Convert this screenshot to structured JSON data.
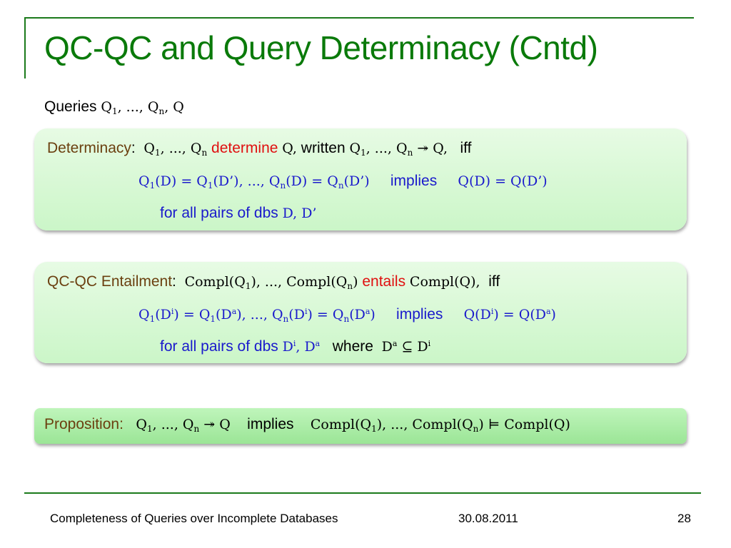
{
  "slide": {
    "title": "QC-QC and Query Determinacy (Cntd)",
    "queries_label": "Queries",
    "queries_math": [
      "Q",
      "1",
      ", ..., Q",
      "n",
      ", Q"
    ]
  },
  "determinacy": {
    "label": "Determinacy",
    "colon": ":",
    "line1": {
      "lhs_q1": "Q",
      "lhs_sub1": "1",
      "lhs_mid": ", ..., Q",
      "lhs_subn": "n",
      "keyword": "determine",
      "q": "Q,",
      "written": "written",
      "arrow_expr": [
        "Q",
        "1",
        ", ..., Q",
        "n",
        " ↠ Q,"
      ],
      "iff": "iff"
    },
    "line2": {
      "cond": [
        "Q",
        "1",
        "(D) = Q",
        "1",
        "(D’), ..., Q",
        "n",
        "(D) = Q",
        "n",
        "(D’)"
      ],
      "implies": "implies",
      "result": "Q(D) = Q(D’)"
    },
    "line3": {
      "text": "for all pairs of dbs",
      "dbs": "D, D’"
    }
  },
  "entailment": {
    "label": "QC-QC Entailment",
    "colon": ":",
    "line1": {
      "lhs": [
        "Compl(Q",
        "1",
        "), ..., Compl(Q",
        "n",
        ")"
      ],
      "keyword": "entails",
      "rhs": "Compl(Q),",
      "iff": "iff"
    },
    "line2": {
      "cond": [
        "Q",
        "1",
        "(D",
        "i",
        ") = Q",
        "1",
        "(D",
        "a",
        "), ..., Q",
        "n",
        "(D",
        "i",
        ") = Q",
        "n",
        "(D",
        "a",
        ")"
      ],
      "implies": "implies",
      "result": [
        "Q(D",
        "i",
        ") = Q(D",
        "a",
        ")"
      ]
    },
    "line3": {
      "text": "for all pairs of dbs",
      "dbs": [
        "D",
        "i",
        ", D",
        "a"
      ],
      "where": "where",
      "subset": [
        "D",
        "a",
        " ⊆ D",
        "i"
      ]
    }
  },
  "proposition": {
    "label": "Proposition",
    "colon": ":",
    "lhs": [
      "Q",
      "1",
      ", ..., Q",
      "n",
      " ↠ Q"
    ],
    "implies": "implies",
    "rhs": [
      "Compl(Q",
      "1",
      "), ..., Compl(Q",
      "n",
      ") ⊨ Compl(Q)"
    ]
  },
  "footer": {
    "title": "Completeness of Queries over Incomplete Databases",
    "date": "30.08.2011",
    "page": "28"
  },
  "colors": {
    "title_green": "#0a7a0a",
    "label_brown": "#6b4010",
    "keyword_red": "#e01010",
    "formula_blue": "#1a1acc",
    "box_green": "#cbf6c8"
  }
}
